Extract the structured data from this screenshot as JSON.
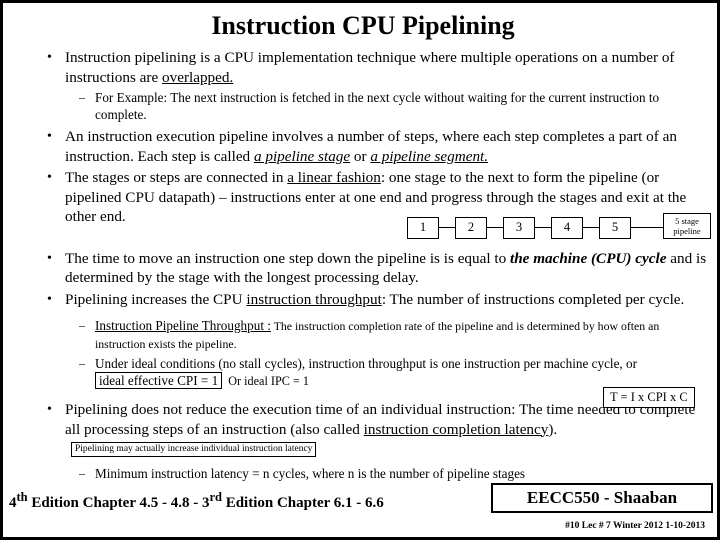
{
  "slide": {
    "title": "Instruction CPU Pipelining",
    "bullets": {
      "b1_part1": "Instruction pipelining is a CPU implementation technique where multiple operations on a number of instructions are ",
      "b1_underline": "overlapped.",
      "s1": "For Example: The next instruction is fetched in the next cycle without waiting for the current instruction to complete.",
      "b2_part1": "An instruction execution pipeline involves a number of steps, where each step completes a part of an instruction.  Each step is called ",
      "b2_italic1": "a pipeline stage",
      "b2_mid": " or ",
      "b2_italic2": "a pipeline segment.",
      "b3_part1": "The stages or steps are connected in ",
      "b3_underline": "a linear fashion",
      "b3_part2": ":  one stage to the next to form the pipeline (or pipelined CPU datapath) – instructions enter at one end and progress through the stages and exit at the other end.",
      "b4_part1": "The time to move an instruction one step down the pipeline is is equal to ",
      "b4_italic": "the machine (CPU) cycle",
      "b4_part2": " and is determined by the stage with the longest processing delay.",
      "b5_part1": "Pipelining increases the CPU ",
      "b5_underline": "instruction throughput",
      "b5_part2": ":  The number of instructions completed per cycle.",
      "s2_underline": "Instruction Pipeline Throughput :",
      "s2_rest": " The instruction completion rate of the pipeline and is determined by how often an instruction exists the pipeline.",
      "s3_part1": "Under ideal conditions (no stall cycles),  instruction throughput is one instruction per machine cycle, or ",
      "s3_boxed": "ideal effective CPI = 1",
      "s3_after": "Or ideal IPC = 1",
      "b6_part1": "Pipelining does not reduce the execution time of an individual instruction:  The time needed to complete all processing steps of an instruction (also called ",
      "b6_underline": "instruction completion latency",
      "b6_part2": ").",
      "b6_note": "Pipelining may actually increase individual instruction latency",
      "s4": "Minimum instruction latency =  n cycles,   where n is the number of pipeline stages"
    },
    "pipeline_diagram": {
      "stages": [
        "1",
        "2",
        "3",
        "4",
        "5"
      ],
      "label_line1": "5 stage",
      "label_line2": "pipeline"
    },
    "tcpi_box": "T = I x CPI  x C",
    "footer": {
      "left_part1": "4",
      "left_sup1": "th",
      "left_mid1": " Edition Chapter 4.5 - 4.8",
      "left_dash": "  -   ",
      "left_part2": "3",
      "left_sup2": "rd",
      "left_mid2": " Edition Chapter  6.1 - 6.6",
      "badge": "EECC550 - Shaaban",
      "note": "#10   Lec # 7  Winter 2012  1-10-2013"
    }
  }
}
